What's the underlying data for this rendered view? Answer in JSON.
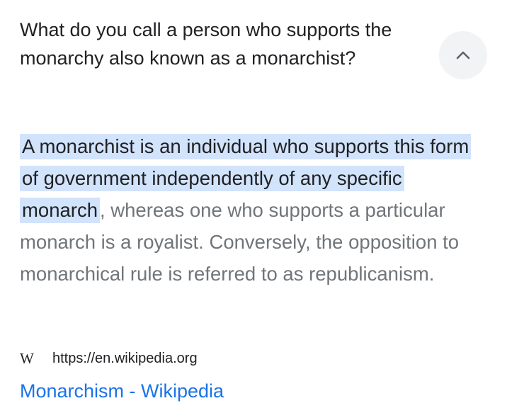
{
  "question": {
    "text": "What do you call a person who supports the monarchy also known as a monarchist?",
    "collapse_icon": "chevron-up-icon"
  },
  "answer": {
    "highlighted": "A monarchist is an individual who supports this form of government independently of any specific monarch",
    "rest": ", whereas one who supports a particular monarch is a royalist. Conversely, the opposition to monarchical rule is referred to as republicanism."
  },
  "source": {
    "icon": "wikipedia-icon",
    "icon_glyph": "W",
    "url": "https://en.wikipedia.org",
    "title": "Monarchism - Wikipedia"
  },
  "colors": {
    "highlight": "#d2e3fc",
    "link": "#1a73e8",
    "text": "#202124",
    "muted": "#70757a"
  }
}
